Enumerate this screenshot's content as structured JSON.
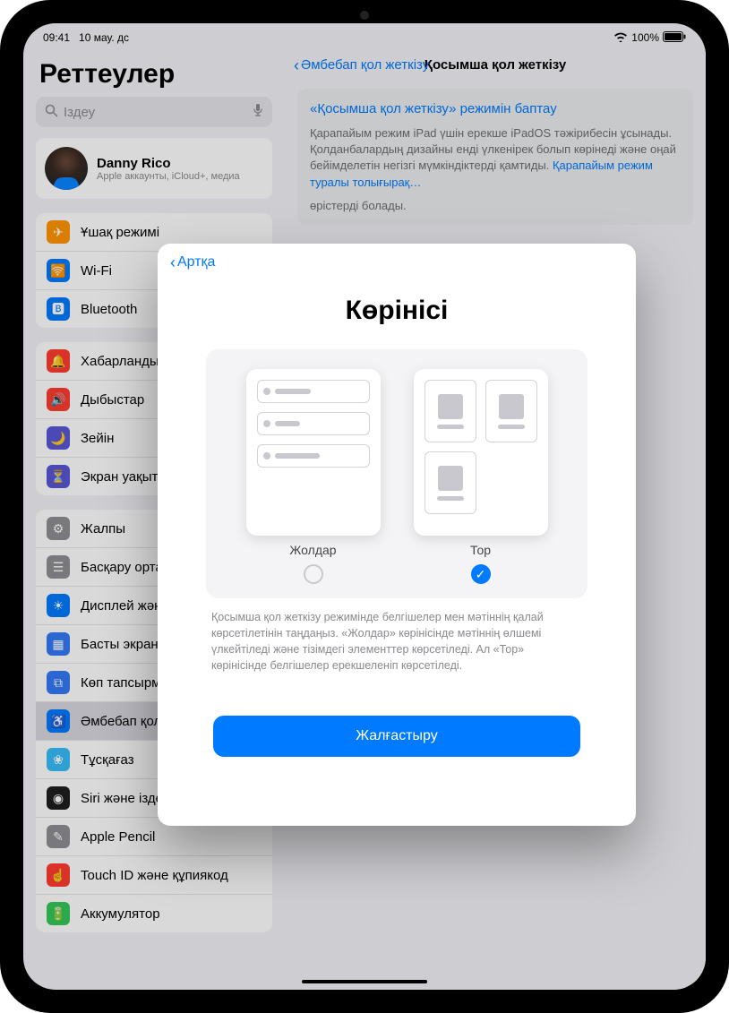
{
  "status": {
    "time": "09:41",
    "date": "10 мау. дс",
    "battery": "100%"
  },
  "sidebar": {
    "title": "Реттеулер",
    "search_placeholder": "Іздеу",
    "account": {
      "name": "Danny Rico",
      "sub": "Apple аккаунты, iCloud+, медиа"
    },
    "group1": [
      {
        "label": "Ұшақ режимі",
        "color": "#ff9500",
        "glyph": "✈"
      },
      {
        "label": "Wi-Fi",
        "color": "#007aff",
        "glyph": "🛜"
      },
      {
        "label": "Bluetooth",
        "color": "#007aff",
        "glyph": "🅱"
      }
    ],
    "group2": [
      {
        "label": "Хабарландырулар",
        "color": "#ff3b30",
        "glyph": "🔔"
      },
      {
        "label": "Дыбыстар",
        "color": "#ff3b30",
        "glyph": "🔊"
      },
      {
        "label": "Зейін",
        "color": "#5856d6",
        "glyph": "🌙"
      },
      {
        "label": "Экран уақыты",
        "color": "#5856d6",
        "glyph": "⏳"
      }
    ],
    "group3": [
      {
        "label": "Жалпы",
        "color": "#8e8e93",
        "glyph": "⚙"
      },
      {
        "label": "Басқару орталығы",
        "color": "#8e8e93",
        "glyph": "☰"
      },
      {
        "label": "Дисплей және жарықтық",
        "color": "#007aff",
        "glyph": "☀"
      },
      {
        "label": "Басты экран және қолданбалар",
        "color": "#3478f6",
        "glyph": "▦"
      },
      {
        "label": "Көп тапсырма және қимылдар",
        "color": "#3478f6",
        "glyph": "⧉"
      },
      {
        "label": "Әмбебап қол жеткізу",
        "color": "#007aff",
        "glyph": "♿"
      },
      {
        "label": "Тұсқағаз",
        "color": "#38bdf8",
        "glyph": "❀"
      },
      {
        "label": "Siri және іздеу",
        "color": "#1e1e1e",
        "glyph": "◉"
      },
      {
        "label": "Apple Pencil",
        "color": "#8e8e93",
        "glyph": "✎"
      },
      {
        "label": "Touch ID және құпиякод",
        "color": "#ff3b30",
        "glyph": "☝"
      },
      {
        "label": "Аккумулятор",
        "color": "#34c759",
        "glyph": "🔋"
      }
    ],
    "selected_label": "Әмбебап қол жеткізу"
  },
  "detail": {
    "back_label": "Әмбебап қол жеткізу",
    "title": "Қосымша қол жеткізу",
    "card": {
      "heading": "«Қосымша қол жеткізу» режимін баптау",
      "body": "Қарапайым режим iPad үшін ерекше iPadOS тәжірибесін ұсынады. Қолданбалардың дизайны енді үлкенірек болып көрінеді және оңай бейімделетін негізгі мүмкіндіктерді қамтиды. ",
      "link": "Қарапайым режим туралы толығырақ…",
      "tail": " өрістерді болады."
    }
  },
  "sheet": {
    "back": "Артқа",
    "title": "Көрінісі",
    "option_rows": "Жолдар",
    "option_grid": "Тор",
    "explain": "Қосымша қол жеткізу режимінде белгішелер мен мәтіннің қалай көрсетілетінін таңдаңыз. «Жолдар» көрінісінде мәтіннің өлшемі үлкейтіледі және тізімдегі элементтер көрсетіледі. Ал «Тор» көрінісінде белгішелер ерекшеленіп көрсетіледі.",
    "continue": "Жалғастыру"
  }
}
